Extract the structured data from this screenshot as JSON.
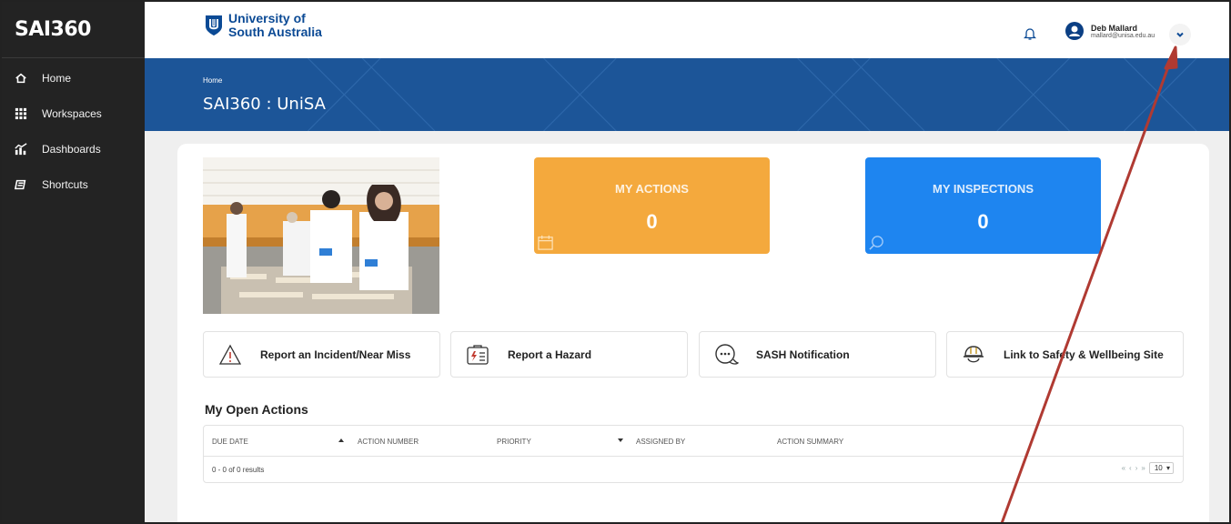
{
  "app": {
    "logo": "SAI360"
  },
  "sidebar": {
    "items": [
      {
        "label": "Home",
        "icon": "home-icon"
      },
      {
        "label": "Workspaces",
        "icon": "grid-icon"
      },
      {
        "label": "Dashboards",
        "icon": "chart-icon"
      },
      {
        "label": "Shortcuts",
        "icon": "shortcut-icon"
      }
    ]
  },
  "header": {
    "org_line1": "University of",
    "org_line2": "South Australia",
    "user_name": "Deb Mallard",
    "user_email": "mallard@unisa.edu.au"
  },
  "banner": {
    "breadcrumb": "Home",
    "title": "SAI360 : UniSA"
  },
  "tiles": {
    "actions": {
      "label": "MY ACTIONS",
      "count": "0",
      "color": "#f4a93d"
    },
    "inspections": {
      "label": "MY INSPECTIONS",
      "count": "0",
      "color": "#1e85f0"
    }
  },
  "quick_links": [
    {
      "label": "Report an Incident/Near Miss",
      "icon": "warning-icon"
    },
    {
      "label": "Report a Hazard",
      "icon": "hazard-form-icon"
    },
    {
      "label": "SASH Notification",
      "icon": "chat-bubble-icon"
    },
    {
      "label": "Link to Safety & Wellbeing Site",
      "icon": "hard-hat-icon"
    }
  ],
  "open_actions": {
    "title": "My Open Actions",
    "columns": [
      "DUE DATE",
      "ACTION NUMBER",
      "PRIORITY",
      "ASSIGNED BY",
      "ACTION SUMMARY"
    ],
    "results": "0 - 0 of 0 results",
    "pager": {
      "first": "«",
      "prev": "‹",
      "next": "›",
      "last": "»",
      "page_size": "10"
    }
  },
  "colors": {
    "sidebar": "#232323",
    "banner": "#1c5598",
    "brand_blue": "#0b4a95",
    "arrow": "#b03a32"
  }
}
